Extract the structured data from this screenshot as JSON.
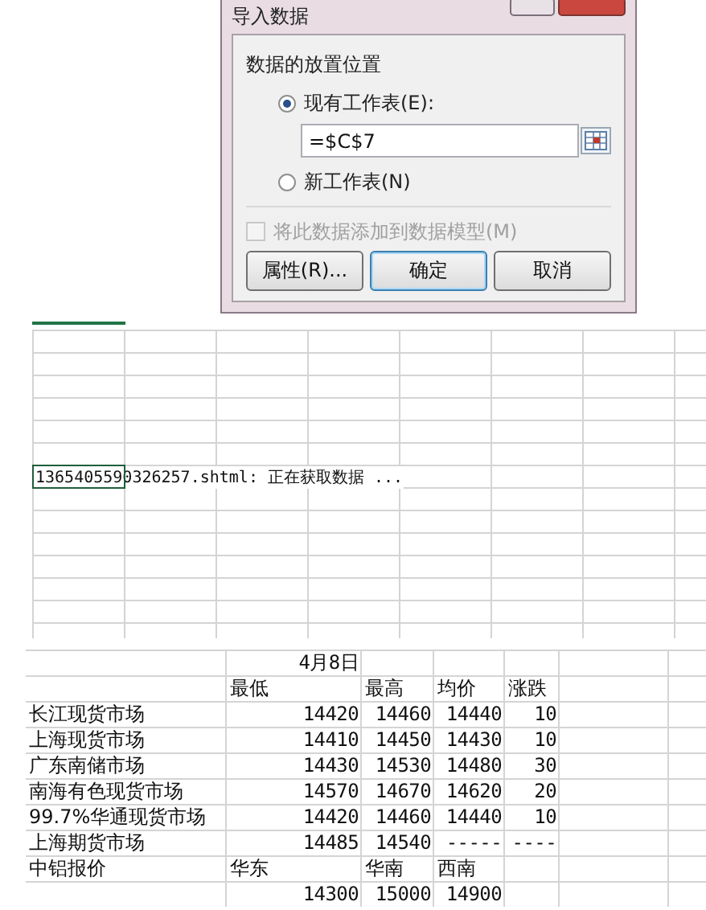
{
  "dialog": {
    "title": "导入数据",
    "section_label": "数据的放置位置",
    "options": [
      {
        "label": "现有工作表(E):",
        "selected": true
      },
      {
        "label": "新工作表(N)",
        "selected": false
      }
    ],
    "location_field": {
      "value": "=$C$7"
    },
    "data_model_checkbox": {
      "label": "将此数据添加到数据模型(M)",
      "checked": false,
      "disabled": true
    },
    "buttons": [
      {
        "label": "属性(R)...",
        "kind": "normal"
      },
      {
        "label": "确定",
        "kind": "default"
      },
      {
        "label": "取消",
        "kind": "normal"
      }
    ]
  },
  "sheet": {
    "status_cell": "1365405590326257.shtml: 正在获取数据 ..."
  },
  "price_table": {
    "date": "4月8日",
    "columns": [
      "最低",
      "最高",
      "均价",
      "涨跌"
    ],
    "rows": [
      {
        "market": "长江现货市场",
        "low": "14420",
        "high": "14460",
        "average": "14440",
        "change": "10"
      },
      {
        "market": "上海现货市场",
        "low": "14410",
        "high": "14450",
        "average": "14430",
        "change": "10"
      },
      {
        "market": "广东南储市场",
        "low": "14430",
        "high": "14530",
        "average": "14480",
        "change": "30"
      },
      {
        "market": "南海有色现货市场",
        "low": "14570",
        "high": "14670",
        "average": "14620",
        "change": "20"
      },
      {
        "market": "99.7%华通现货市场",
        "low": "14420",
        "high": "14460",
        "average": "14440",
        "change": "10"
      },
      {
        "market": "上海期货市场",
        "low": "14485",
        "high": "14540",
        "average": "-----",
        "change": "----"
      }
    ],
    "quote": {
      "label": "中铝报价",
      "regions": [
        "华东",
        "华南",
        "西南"
      ],
      "prices": [
        "14300",
        "15000",
        "14900"
      ]
    }
  }
}
